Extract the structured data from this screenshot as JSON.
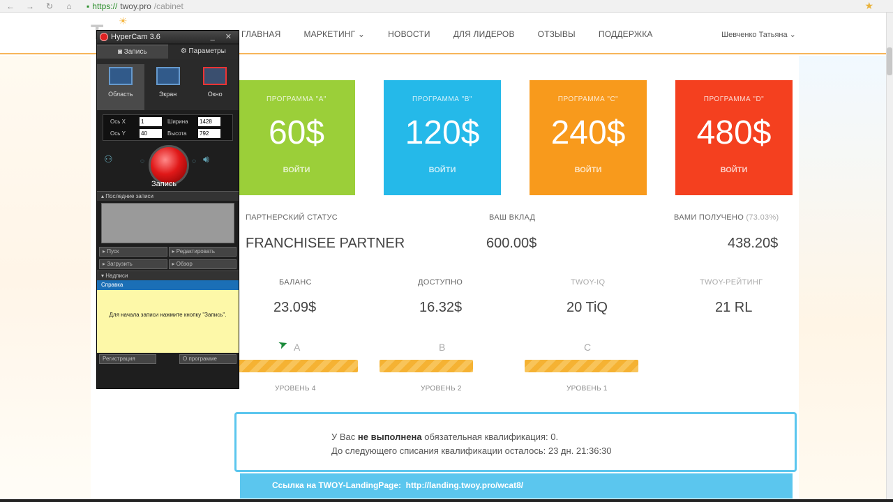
{
  "browser": {
    "back": "←",
    "forward": "→",
    "reload": "↻",
    "home": "⌂",
    "url_scheme": "https://",
    "url_host": "twoy.pro",
    "url_path": "/cabinet",
    "star": "★"
  },
  "header": {
    "logo": "T",
    "nav": [
      "ГЛАВНАЯ",
      "МАРКЕТИНГ ⌄",
      "НОВОСТИ",
      "ДЛЯ ЛИДЕРОВ",
      "ОТЗЫВЫ",
      "ПОДДЕРЖКА"
    ],
    "user": "Шевченко Татьяна ⌄"
  },
  "programs": [
    {
      "name": "ПРОГРАММА \"A\"",
      "price": "60$",
      "action": "ВОЙТИ",
      "color": "#9bcf39"
    },
    {
      "name": "ПРОГРАММА \"B\"",
      "price": "120$",
      "action": "ВОЙТИ",
      "color": "#25b9e9"
    },
    {
      "name": "ПРОГРАММА \"C\"",
      "price": "240$",
      "action": "ВОЙТИ",
      "color": "#f89a1c"
    },
    {
      "name": "ПРОГРАММА \"D\"",
      "price": "480$",
      "action": "ВОЙТИ",
      "color": "#f4401f"
    }
  ],
  "status": {
    "partner_label": "ПАРТНЕРСКИЙ СТАТУС",
    "partner_value": "FRANCHISEE PARTNER",
    "deposit_label": "ВАШ ВКЛАД",
    "deposit_value": "600.00$",
    "received_label": "ВАМИ ПОЛУЧЕНО",
    "received_pct": "(73.03%)",
    "received_value": "438.20$"
  },
  "balance": {
    "balance_label": "БАЛАНС",
    "balance_value": "23.09$",
    "available_label": "ДОСТУПНО",
    "available_value": "16.32$",
    "tiq_label": "TWOY-IQ",
    "tiq_value": "20 TiQ",
    "rating_label": "TWOY-РЕЙТИНГ",
    "rating_value": "21 RL"
  },
  "levels": [
    {
      "letter": "A",
      "label": "УРОВЕНЬ 4"
    },
    {
      "letter": "B",
      "label": "УРОВЕНЬ 2"
    },
    {
      "letter": "C",
      "label": "УРОВЕНЬ 1"
    }
  ],
  "qualification": {
    "prefix": "У Вас",
    "bold": "не выполнена",
    "suffix": "обязательная квалификация: 0.",
    "line2": "До следующего списания квалификации осталось: 23 дн. 21:36:30"
  },
  "landing": {
    "label": "Ссылка на TWOY-LandingPage:",
    "url": "http://landing.twoy.pro/wcat8/"
  },
  "hypercam": {
    "title": "HyperCam 3.6",
    "window_buttons": "_ ✕",
    "tab_record": "Запись",
    "tab_params": "Параметры",
    "modes": [
      "Область",
      "Экран",
      "Окно"
    ],
    "x_label": "Ось X",
    "x_value": "1",
    "y_label": "Ось Y",
    "y_value": "40",
    "w_label": "Ширина",
    "w_value": "1428",
    "h_label": "Высота",
    "h_value": "792",
    "record_label": "Запись",
    "recent": "Последние записи",
    "btn_play": "Пуск",
    "btn_edit": "Редактировать",
    "btn_upload": "Загрузить",
    "btn_browse": "Обзор",
    "captions": "Надписи",
    "help": "Справка",
    "help_text": "Для начала записи нажмите кнопку \"Запись\".",
    "register": "Регистрация",
    "about": "О программе"
  }
}
